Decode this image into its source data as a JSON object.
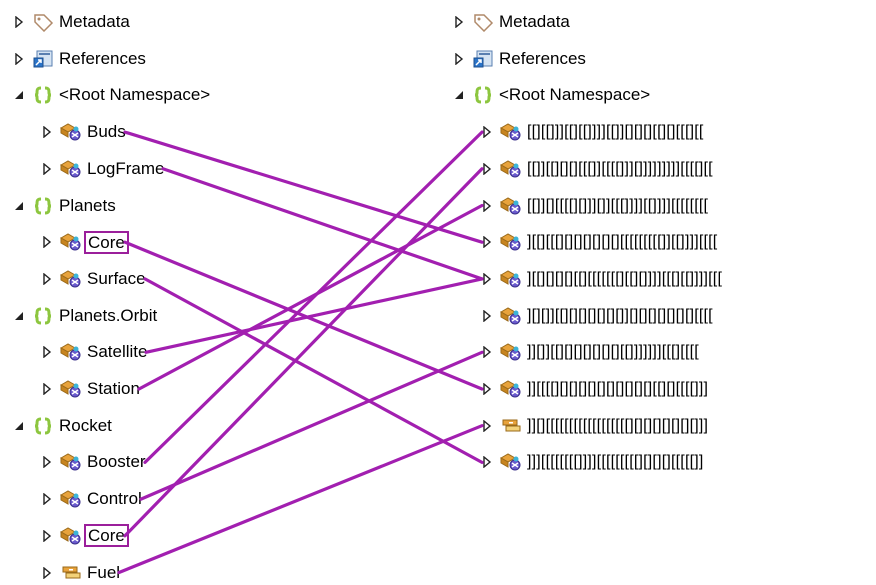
{
  "left_tree": [
    {
      "label": "Metadata",
      "icon": "tag-icon",
      "expander": "collapsed",
      "level": 0
    },
    {
      "label": "References",
      "icon": "references-icon",
      "expander": "collapsed",
      "level": 0
    },
    {
      "label": "<Root Namespace>",
      "icon": "namespace-icon",
      "expander": "expanded",
      "level": 0
    },
    {
      "label": "Buds",
      "icon": "class-icon",
      "expander": "collapsed",
      "level": 1
    },
    {
      "label": "LogFrame",
      "icon": "class-icon",
      "expander": "collapsed",
      "level": 1
    },
    {
      "label": "Planets",
      "icon": "namespace-icon",
      "expander": "expanded",
      "level": 0
    },
    {
      "label": "Core",
      "icon": "class-icon",
      "expander": "collapsed",
      "level": 1,
      "highlighted": true
    },
    {
      "label": "Surface",
      "icon": "class-icon",
      "expander": "collapsed",
      "level": 1
    },
    {
      "label": "Planets.Orbit",
      "icon": "namespace-icon",
      "expander": "expanded",
      "level": 0
    },
    {
      "label": "Satellite",
      "icon": "class-icon",
      "expander": "collapsed",
      "level": 1
    },
    {
      "label": "Station",
      "icon": "class-icon",
      "expander": "collapsed",
      "level": 1
    },
    {
      "label": "Rocket",
      "icon": "namespace-icon",
      "expander": "expanded",
      "level": 0
    },
    {
      "label": "Booster",
      "icon": "class-icon",
      "expander": "collapsed",
      "level": 1
    },
    {
      "label": "Control",
      "icon": "class-icon",
      "expander": "collapsed",
      "level": 1
    },
    {
      "label": "Core",
      "icon": "class-icon",
      "expander": "collapsed",
      "level": 1,
      "highlighted": true
    },
    {
      "label": "Fuel",
      "icon": "struct-icon",
      "expander": "collapsed",
      "level": 1
    }
  ],
  "right_tree": [
    {
      "label": "Metadata",
      "icon": "tag-icon",
      "expander": "collapsed",
      "level": 0
    },
    {
      "label": "References",
      "icon": "references-icon",
      "expander": "collapsed",
      "level": 0
    },
    {
      "label": "<Root Namespace>",
      "icon": "namespace-icon",
      "expander": "expanded",
      "level": 0
    },
    {
      "label": "[[][[]]][[][[]]]][[]][][][][[][][[[][[",
      "icon": "class-icon",
      "expander": "collapsed",
      "level": 1
    },
    {
      "label": "[[]][[][][][[[]][[[[]]][]]]]]]]]][[[[][[",
      "icon": "class-icon",
      "expander": "collapsed",
      "level": 1
    },
    {
      "label": "[[]][][[[[][]]][]][[[]]]][[]]]][[[[[[[[",
      "icon": "class-icon",
      "expander": "collapsed",
      "level": 1
    },
    {
      "label": "][[][[[][][][][][][][[[[[[[[[]][[]]]][[[[",
      "icon": "class-icon",
      "expander": "collapsed",
      "level": 1
    },
    {
      "label": "][[][][][][[][[[[[[[][[][]]]][[[][[]]]][[[",
      "icon": "class-icon",
      "expander": "collapsed",
      "level": 1
    },
    {
      "label": "][][]][[][][][][][][]][][][][][][][][[[[",
      "icon": "class-icon",
      "expander": "collapsed",
      "level": 1
    },
    {
      "label": "]][]][[][][][][][][][[]]]]]]][[[][[[[",
      "icon": "class-icon",
      "expander": "collapsed",
      "level": 1
    },
    {
      "label": "]][[[[][][][][][][][][][][][[][][[[[]]]",
      "icon": "class-icon",
      "expander": "collapsed",
      "level": 1
    },
    {
      "label": "]][][[[[[[[[[[[[[[[[[[][][][][][][][]]]",
      "icon": "struct-icon",
      "expander": "collapsed",
      "level": 1
    },
    {
      "label": "]]][[[[[[[[]]]][[[[[[[[[][][][][[[[[]]",
      "icon": "class-icon",
      "expander": "collapsed",
      "level": 1
    }
  ],
  "links": [
    {
      "from": 3,
      "to": 6
    },
    {
      "from": 4,
      "to": 7
    },
    {
      "from": 6,
      "to": 10
    },
    {
      "from": 7,
      "to": 12
    },
    {
      "from": 9,
      "to": 7
    },
    {
      "from": 10,
      "to": 5
    },
    {
      "from": 12,
      "to": 3
    },
    {
      "from": 13,
      "to": 9
    },
    {
      "from": 14,
      "to": 4
    },
    {
      "from": 15,
      "to": 11
    }
  ],
  "colors": {
    "link": "#a21fb0",
    "highlight_box": "#9b1f9b",
    "namespace_icon": "#8dc63f",
    "class_icon": "#e8a33c"
  }
}
